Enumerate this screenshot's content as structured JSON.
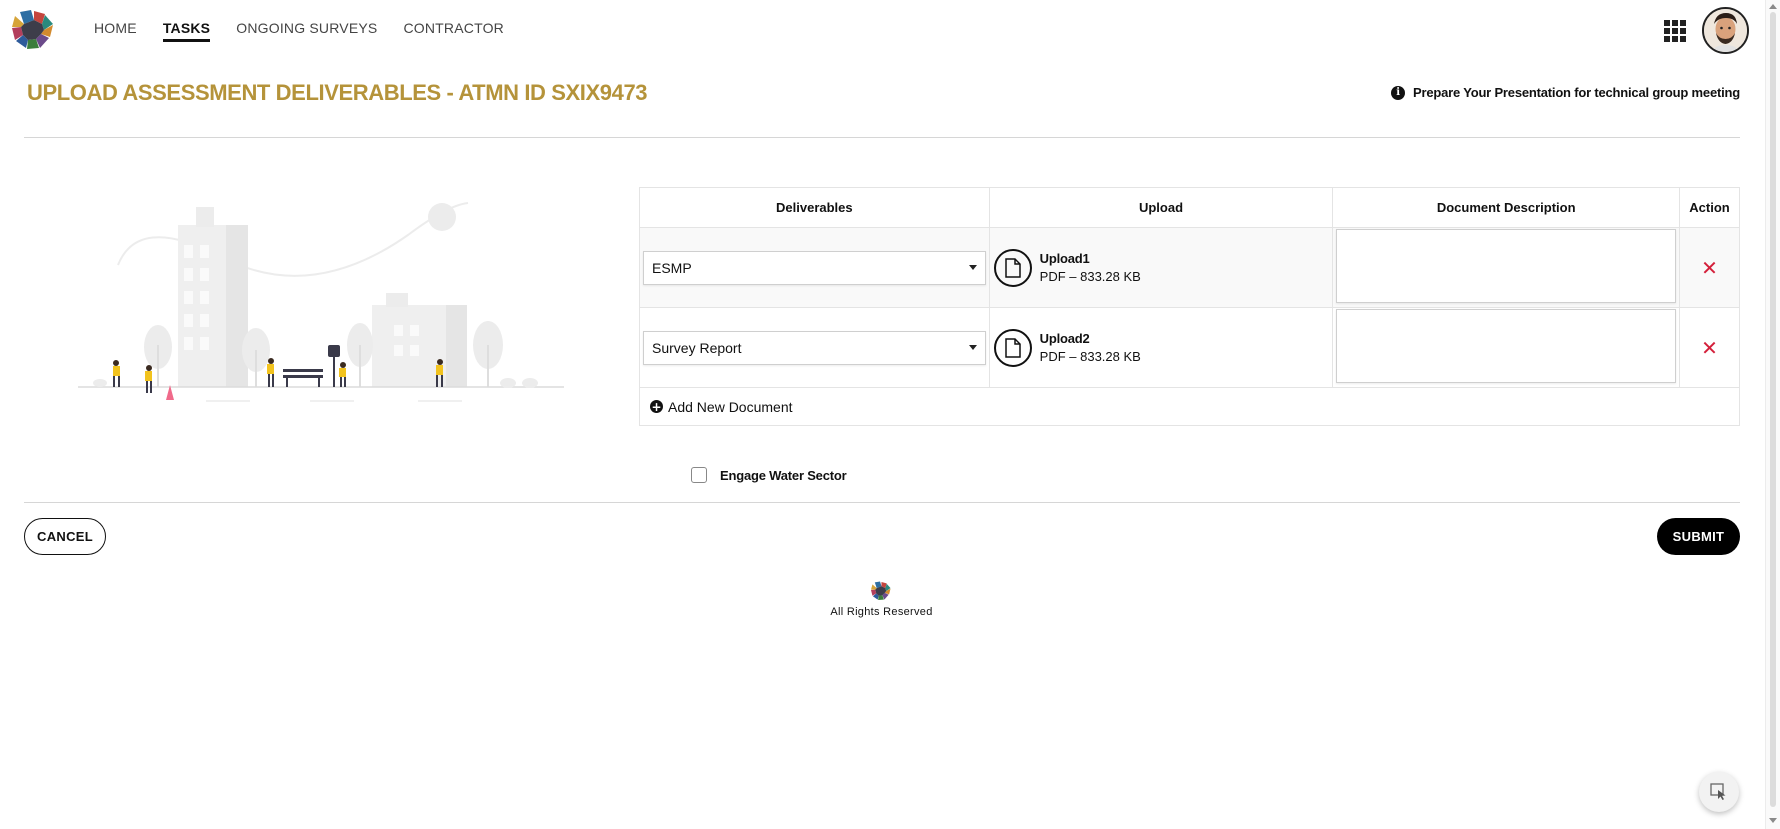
{
  "nav": {
    "items": [
      {
        "label": "HOME",
        "active": false
      },
      {
        "label": "TASKS",
        "active": true
      },
      {
        "label": "ONGOING SURVEYS",
        "active": false
      },
      {
        "label": "CONTRACTOR",
        "active": false
      }
    ]
  },
  "page": {
    "title": "UPLOAD ASSESSMENT DELIVERABLES - ATMN ID SXIX9473",
    "hint": "Prepare Your Presentation for technical group meeting"
  },
  "table": {
    "headers": {
      "deliverables": "Deliverables",
      "upload": "Upload",
      "description": "Document Description",
      "action": "Action"
    },
    "rows": [
      {
        "deliverable": "ESMP",
        "file_name": "Upload1",
        "file_meta": "PDF – 833.28 KB",
        "description": ""
      },
      {
        "deliverable": "Survey Report",
        "file_name": "Upload2",
        "file_meta": "PDF – 833.28 KB",
        "description": ""
      }
    ],
    "add_label": "Add New Document"
  },
  "engage": {
    "label": "Engage Water Sector",
    "checked": false
  },
  "buttons": {
    "cancel": "CANCEL",
    "submit": "SUBMIT"
  },
  "footer": {
    "text": "All Rights Reserved"
  },
  "colors": {
    "accent": "#b5933a",
    "danger": "#d4203b",
    "primary": "#000000"
  },
  "icons": {
    "logo": "colorful-hexagon-logo",
    "apps": "grid-icon",
    "info": "info-icon",
    "file": "document-icon",
    "remove": "close-x-icon",
    "add": "plus-circle-icon"
  }
}
